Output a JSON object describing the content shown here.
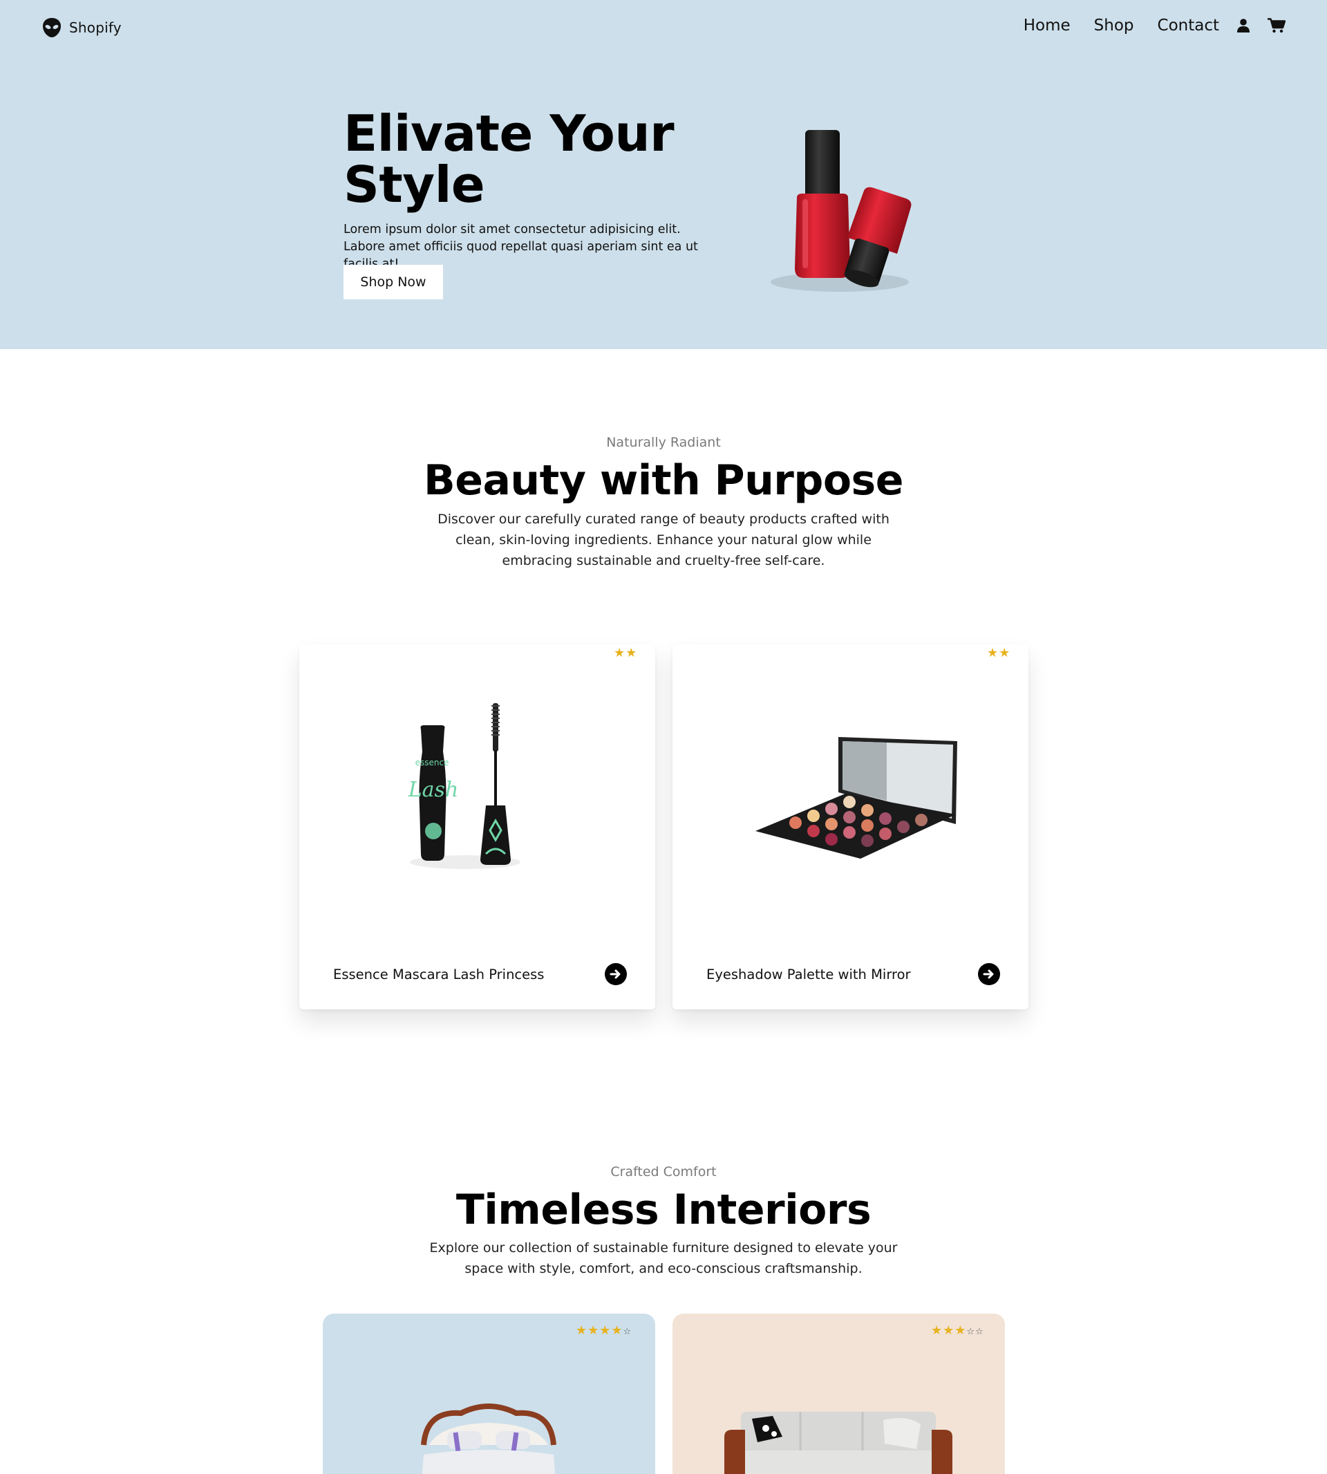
{
  "nav": {
    "brand": "Shopify",
    "links": [
      "Home",
      "Shop",
      "Contact"
    ],
    "icons": [
      "user-icon",
      "cart-icon"
    ]
  },
  "hero": {
    "title": "Elivate Your Style",
    "text": "Lorem ipsum dolor sit amet consectetur adipisicing elit. Labore amet officiis quod repellat quasi aperiam sint ea ut facilis at!",
    "cta": "Shop Now",
    "background": "#cddfea"
  },
  "beauty": {
    "eyebrow": "Naturally Radiant",
    "title": "Beauty with Purpose",
    "description": "Discover our carefully curated range of beauty products crafted with clean, skin-loving ingredients. Enhance your natural glow while embracing sustainable and cruelty-free self-care.",
    "products": [
      {
        "name": "Essence Mascara Lash Princess",
        "rating": 2,
        "stars": "★★"
      },
      {
        "name": "Eyeshadow Palette with Mirror",
        "rating": 2,
        "stars": "★★"
      }
    ]
  },
  "interiors": {
    "eyebrow": "Crafted Comfort",
    "title": "Timeless Interiors",
    "description": "Explore our collection of sustainable furniture designed to elevate your space with style, comfort, and eco-conscious craftsmanship.",
    "products": [
      {
        "rating": 4,
        "stars_filled": "★★★★",
        "stars_empty": "☆",
        "background": "#cddfea"
      },
      {
        "rating": 3,
        "stars_filled": "★★★",
        "stars_empty": "☆☆",
        "background": "#f2e3d6"
      }
    ]
  },
  "colors": {
    "star": "#e8b21e",
    "hero_bg": "#cddfea",
    "peach_bg": "#f2e3d6"
  }
}
